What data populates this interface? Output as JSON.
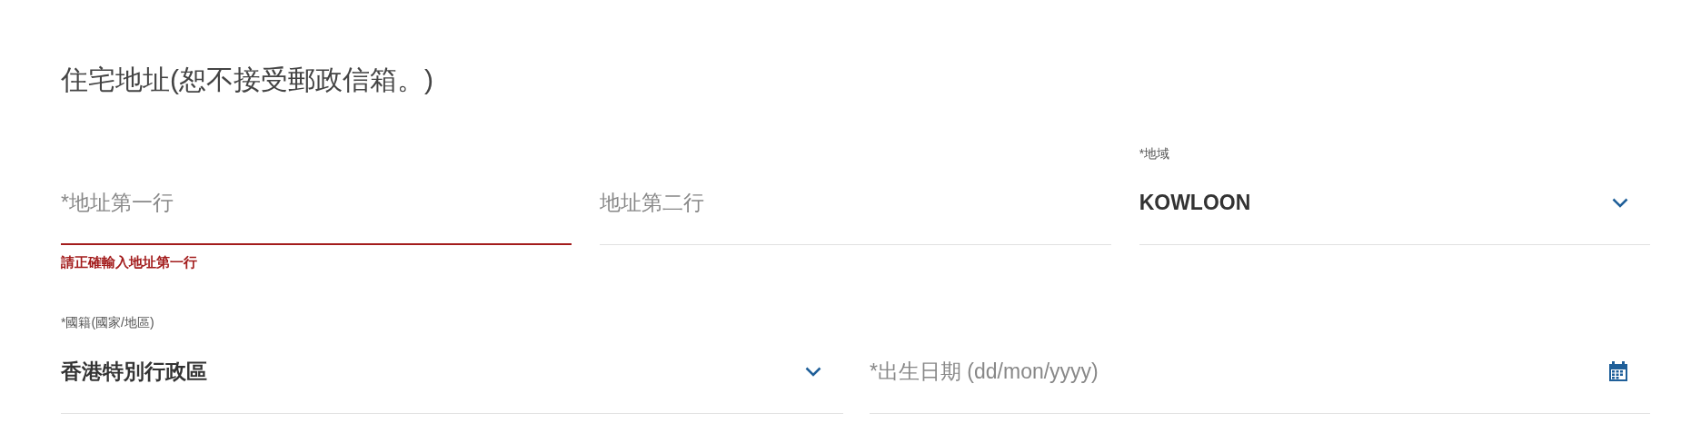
{
  "heading": "住宅地址(恕不接受郵政信箱。)",
  "address_row": [
    {
      "kind": "text",
      "placeholder": "*地址第一行",
      "invalid": true,
      "error": "請正確輸入地址第一行"
    },
    {
      "kind": "text",
      "placeholder": "地址第二行",
      "invalid": false
    },
    {
      "kind": "select",
      "label": "*地域",
      "value": "KOWLOON",
      "invalid": false
    }
  ],
  "personal_row": [
    {
      "kind": "select",
      "label": "*國籍(國家/地區)",
      "value": "香港特別行政區",
      "invalid": false
    },
    {
      "kind": "date",
      "placeholder": "*出生日期 (dd/mon/yyyy)",
      "invalid": false
    }
  ]
}
